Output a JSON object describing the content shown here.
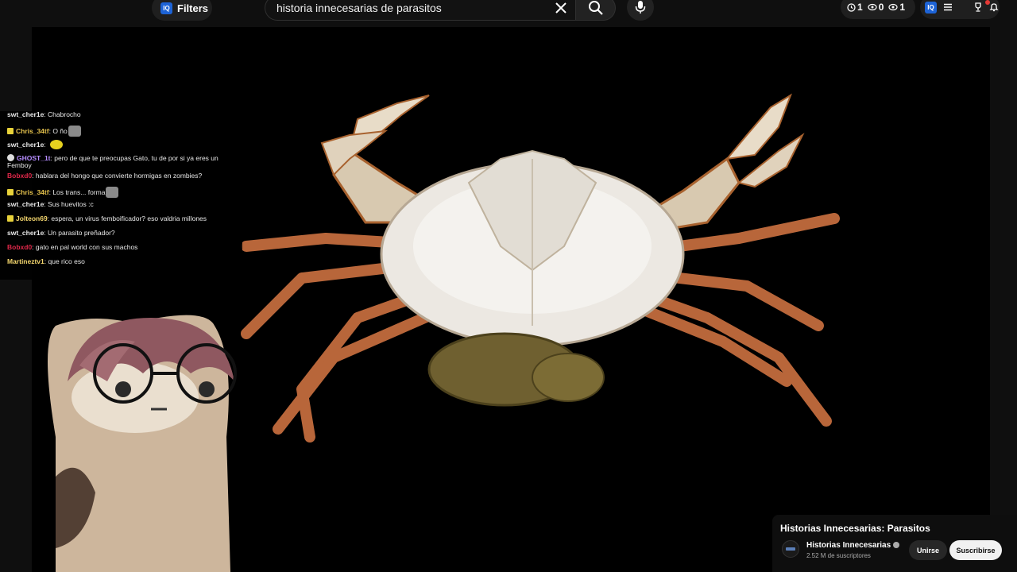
{
  "toolbar": {
    "filters_label": "Filters",
    "iq_badge": "IQ",
    "search_value": "historia innecesarias de parasitos",
    "stats": {
      "history": "1",
      "views": "0",
      "watched": "1"
    },
    "icons": [
      "close-icon",
      "search-icon",
      "mic-icon",
      "clock-icon",
      "eye-off-icon",
      "eye-icon",
      "iq-icon",
      "menu-icon",
      "trophy-icon",
      "bell-icon"
    ]
  },
  "chat": {
    "messages": [
      {
        "user": "swt_cher1e",
        "text": "Chabrocho",
        "color": "#ffffff"
      },
      {
        "user": "Chris_34tf",
        "text": "O ño",
        "color": "#e6c34d",
        "badge": "sub",
        "emote": "cat"
      },
      {
        "user": "swt_cher1e",
        "text": "",
        "color": "#ffffff",
        "emote": "yellow"
      },
      {
        "user": "GHOST_1t",
        "text": "pero de que te preocupas Gato, tu de por si ya eres un Femboy",
        "color": "#b58cff",
        "badge": "mod"
      },
      {
        "user": "Bobxd0",
        "text": "hablara del hongo que convierte hormigas en zombies?",
        "color": "#e0284a"
      },
      {
        "user": "Chris_34tf",
        "text": "Los trans... forma",
        "color": "#e6c34d",
        "badge": "sub",
        "emote": "cat"
      },
      {
        "user": "swt_cher1e",
        "text": "Sus huevitos :c",
        "color": "#ffffff"
      },
      {
        "user": "Jolteon69",
        "text": "espera, un virus femboificador? eso valdria millones",
        "color": "#f5d76e",
        "badge": "sub"
      },
      {
        "user": "swt_cher1e",
        "text": "Un parasito preñador?",
        "color": "#ffffff"
      },
      {
        "user": "Bobxd0",
        "text": "gato en pal world con sus machos",
        "color": "#e0284a"
      },
      {
        "user": "Martineztv1",
        "text": "que rico eso",
        "color": "#f5d76e"
      }
    ]
  },
  "card": {
    "title": "Historias Innecesarias: Parasitos",
    "channel": "Historias Innecesarias",
    "subscribers": "2.52 M de suscriptores",
    "join_label": "Unirse",
    "subscribe_label": "Suscribirse"
  }
}
